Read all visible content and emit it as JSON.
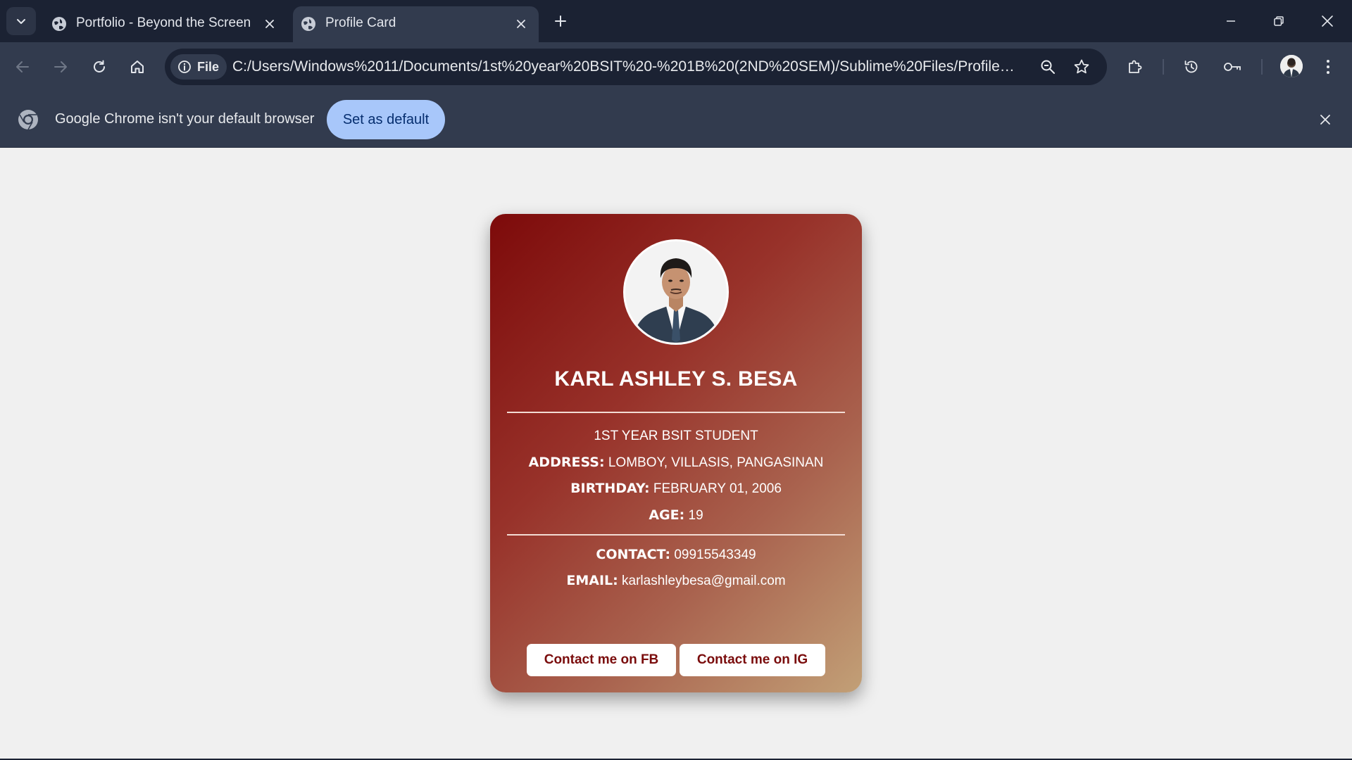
{
  "browser": {
    "tabs": [
      {
        "title": "Portfolio - Beyond the Screen",
        "active": false
      },
      {
        "title": "Profile Card",
        "active": true
      }
    ],
    "address": {
      "scheme_label": "File",
      "url": "C:/Users/Windows%2011/Documents/1st%20year%20BSIT%20-%201B%20(2ND%20SEM)/Sublime%20Files/Profile%20C..."
    },
    "infobar": {
      "message": "Google Chrome isn't your default browser",
      "button_label": "Set as default"
    }
  },
  "card": {
    "name": "KARL ASHLEY S. BESA",
    "role": "1ST YEAR BSIT STUDENT",
    "address": {
      "label": "ADDRESS:",
      "value": "LOMBOY, VILLASIS, PANGASINAN"
    },
    "birthday": {
      "label": "BIRTHDAY:",
      "value": "FEBRUARY 01, 2006"
    },
    "age": {
      "label": "AGE:",
      "value": "19"
    },
    "contact": {
      "label": "CONTACT:",
      "value": "09915543349"
    },
    "email": {
      "label": "EMAIL:",
      "value": "karlashleybesa@gmail.com"
    },
    "buttons": {
      "fb": "Contact me on FB",
      "ig": "Contact me on IG"
    }
  },
  "colors": {
    "card_gradient": [
      "#7d0a0a",
      "#98322a",
      "#a9624e",
      "#c2a077"
    ],
    "card_button_text": "#7a0c0c",
    "default_button": "#a8c7fa",
    "chrome_dark": "#1b2233",
    "chrome_mid": "#323b4e"
  }
}
